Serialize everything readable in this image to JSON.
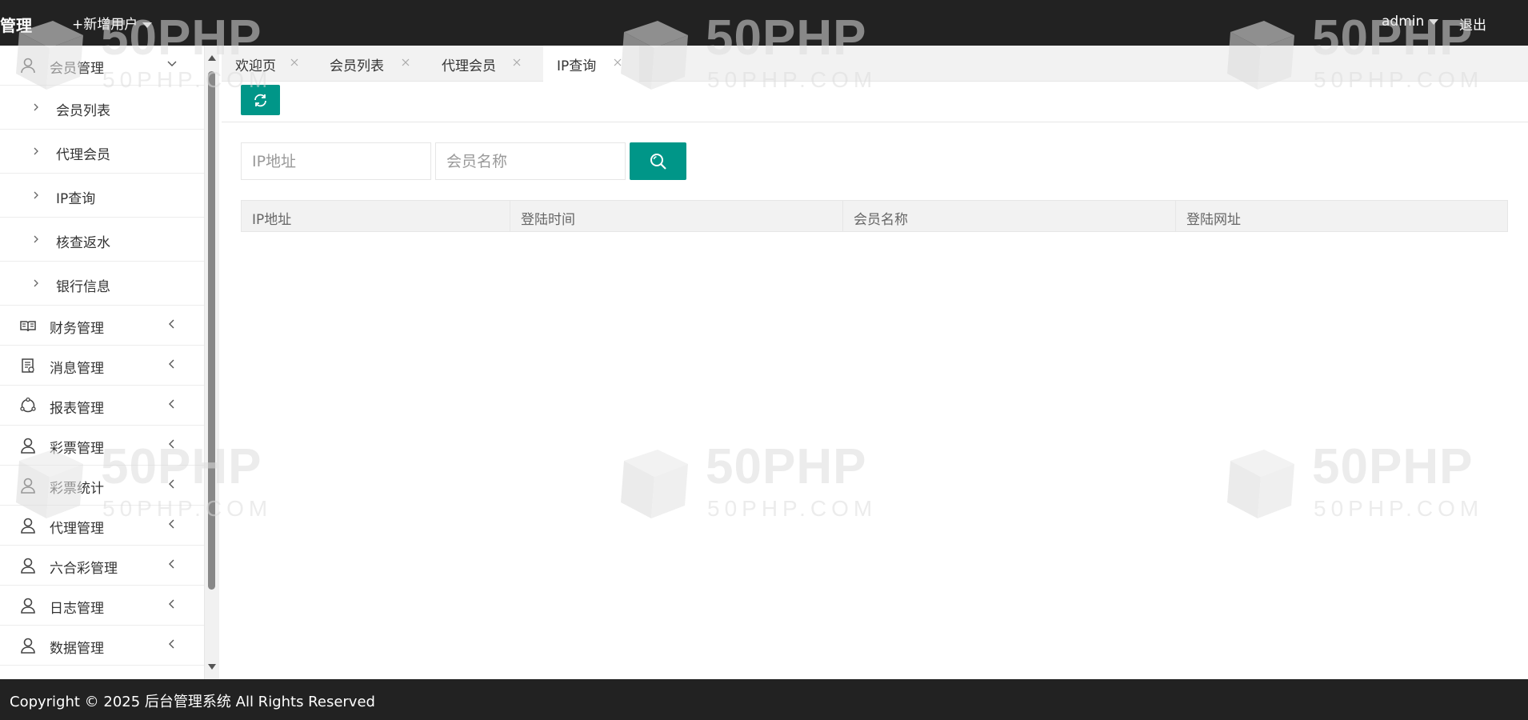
{
  "header": {
    "logo": "管理",
    "add_user": "+新增用户",
    "admin": "admin",
    "logout": "退出"
  },
  "sidebar": {
    "member_group": {
      "label": "会员管理",
      "children": [
        "会员列表",
        "代理会员",
        "IP查询",
        "核查返水",
        "银行信息"
      ]
    },
    "items": [
      {
        "label": "财务管理",
        "icon": "book-icon"
      },
      {
        "label": "消息管理",
        "icon": "message-icon"
      },
      {
        "label": "报表管理",
        "icon": "report-icon"
      },
      {
        "label": "彩票管理",
        "icon": "user-icon"
      },
      {
        "label": "彩票统计",
        "icon": "user-icon"
      },
      {
        "label": "代理管理",
        "icon": "user-icon"
      },
      {
        "label": "六合彩管理",
        "icon": "user-icon"
      },
      {
        "label": "日志管理",
        "icon": "user-icon"
      },
      {
        "label": "数据管理",
        "icon": "user-icon"
      }
    ]
  },
  "tabs": [
    {
      "label": "欢迎页",
      "active": false
    },
    {
      "label": "会员列表",
      "active": false
    },
    {
      "label": "代理会员",
      "active": false
    },
    {
      "label": "IP查询",
      "active": true
    }
  ],
  "search": {
    "ip_placeholder": "IP地址",
    "name_placeholder": "会员名称"
  },
  "table": {
    "columns": [
      "IP地址",
      "登陆时间",
      "会员名称",
      "登陆网址"
    ]
  },
  "footer": {
    "copyright": "Copyright © 2025 后台管理系统 All Rights Reserved"
  },
  "watermark": {
    "big": "50PHP",
    "small": "50PHP.COM"
  },
  "colors": {
    "accent": "#009688",
    "header_bg": "#222222"
  }
}
